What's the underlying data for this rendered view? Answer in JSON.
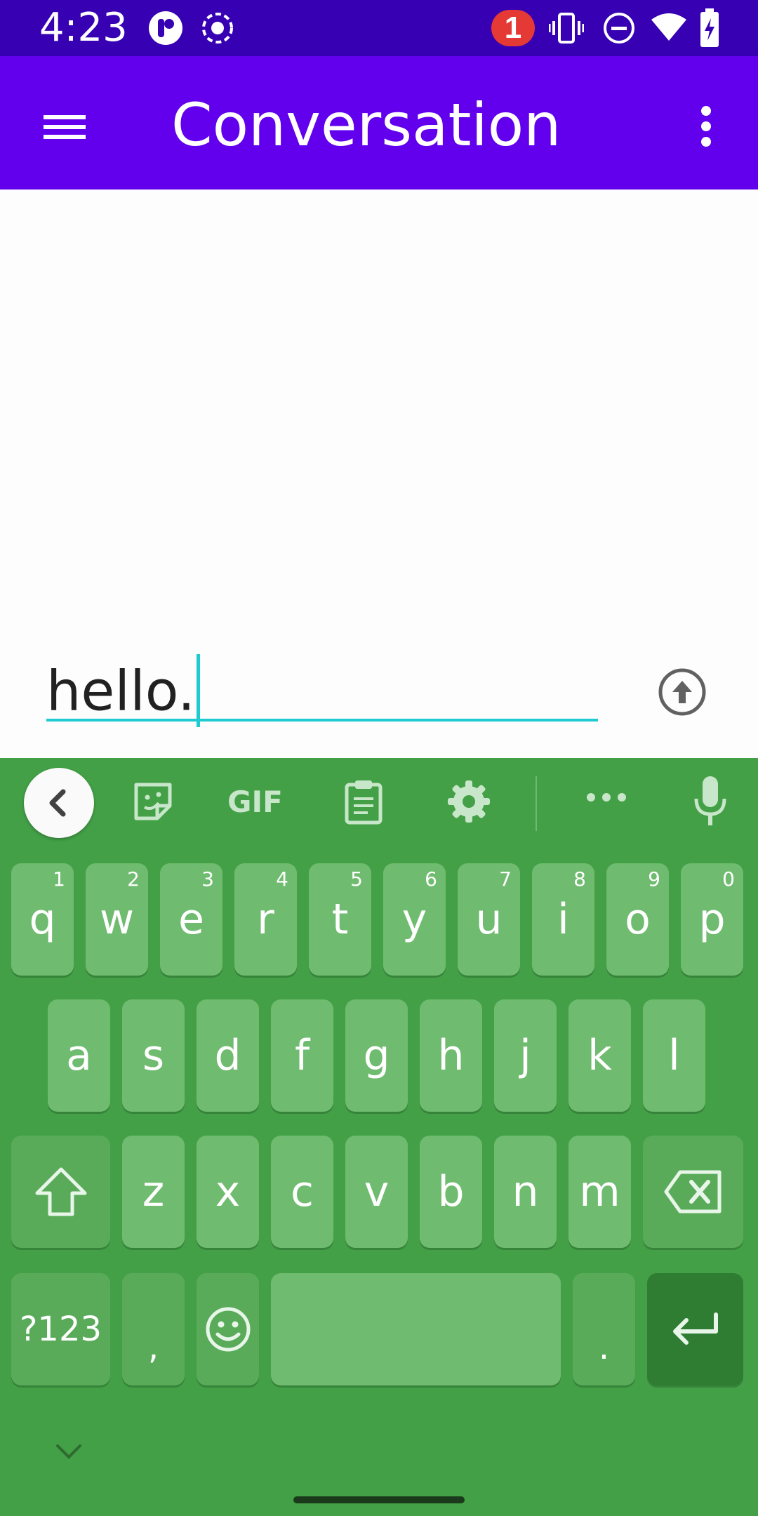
{
  "status_bar": {
    "time": "4:23",
    "notification_count": "1",
    "icons": [
      "app-icon",
      "record-icon",
      "vibrate-icon",
      "do-not-disturb-icon",
      "wifi-icon",
      "battery-charging-icon"
    ]
  },
  "app_bar": {
    "title": "Conversation",
    "menu_icon": "hamburger-menu-icon",
    "overflow_icon": "more-vert-icon"
  },
  "compose": {
    "value": "hello.",
    "send_icon": "send-arrow-up-icon"
  },
  "keyboard": {
    "toolbar": [
      "back-icon",
      "sticker-icon",
      "gif-icon",
      "clipboard-icon",
      "settings-icon",
      "more-icon",
      "mic-icon"
    ],
    "gif_label": "GIF",
    "row1": [
      {
        "k": "q",
        "n": "1"
      },
      {
        "k": "w",
        "n": "2"
      },
      {
        "k": "e",
        "n": "3"
      },
      {
        "k": "r",
        "n": "4"
      },
      {
        "k": "t",
        "n": "5"
      },
      {
        "k": "y",
        "n": "6"
      },
      {
        "k": "u",
        "n": "7"
      },
      {
        "k": "i",
        "n": "8"
      },
      {
        "k": "o",
        "n": "9"
      },
      {
        "k": "p",
        "n": "0"
      }
    ],
    "row2": [
      "a",
      "s",
      "d",
      "f",
      "g",
      "h",
      "j",
      "k",
      "l"
    ],
    "row3": [
      "z",
      "x",
      "c",
      "v",
      "b",
      "n",
      "m"
    ],
    "symbols_label": "?123",
    "comma_label": ",",
    "period_label": ".",
    "colors": {
      "background": "#43a047",
      "key": "#6fbb6f",
      "enter": "#2e7d32"
    }
  },
  "colors": {
    "status_bar": "#3700b3",
    "app_bar": "#6200ee",
    "accent": "#1ecbd1"
  }
}
